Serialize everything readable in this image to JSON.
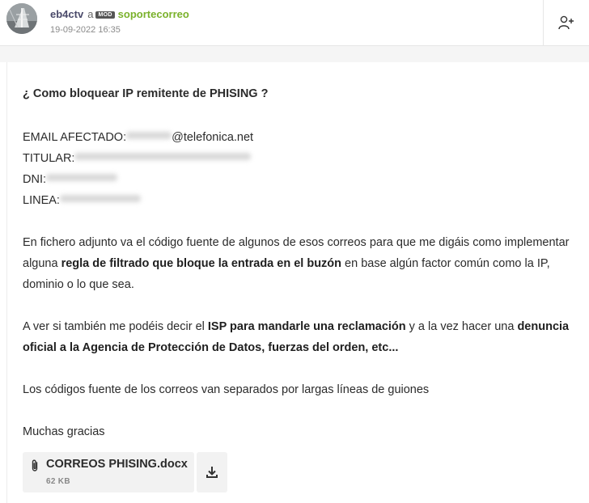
{
  "author": {
    "username": "eb4ctv",
    "connector": "a",
    "badge": "MOD",
    "forum": "soportecorreo",
    "datetime": "19-09-2022 16:35"
  },
  "header": {
    "follow_icon": "add-user-icon"
  },
  "post": {
    "title": "¿ Como bloquear IP remitente de PHISING ?",
    "fields": [
      {
        "label": "EMAIL AFECTADO:",
        "suffix": "@telefonica.net"
      },
      {
        "label": "TITULAR:",
        "suffix": ""
      },
      {
        "label": "DNI:",
        "suffix": ""
      },
      {
        "label": "LINEA:",
        "suffix": ""
      }
    ],
    "p1": {
      "t1": "En fichero adjunto va el código fuente de algunos de esos correos para que me digáis como implementar alguna ",
      "b1": "regla de filtrado que bloque la entrada en el buzón",
      "t2": " en base algún factor común como la IP, dominio o lo que sea."
    },
    "p2": {
      "t1": "A ver si también me podéis decir el ",
      "b1": "ISP para mandarle una reclamación",
      "t2": " y  a la vez hacer una ",
      "b2": "denuncia oficial a la Agencia de Protección de Datos, fuerzas del orden, etc..."
    },
    "p3": "Los códigos fuente de los correos van separados por largas líneas de guiones",
    "p4": "Muchas gracias"
  },
  "attachment": {
    "filename": "CORREOS PHISING.docx",
    "size": "62 KB",
    "clip_icon": "paperclip-icon",
    "download_icon": "download-icon"
  }
}
